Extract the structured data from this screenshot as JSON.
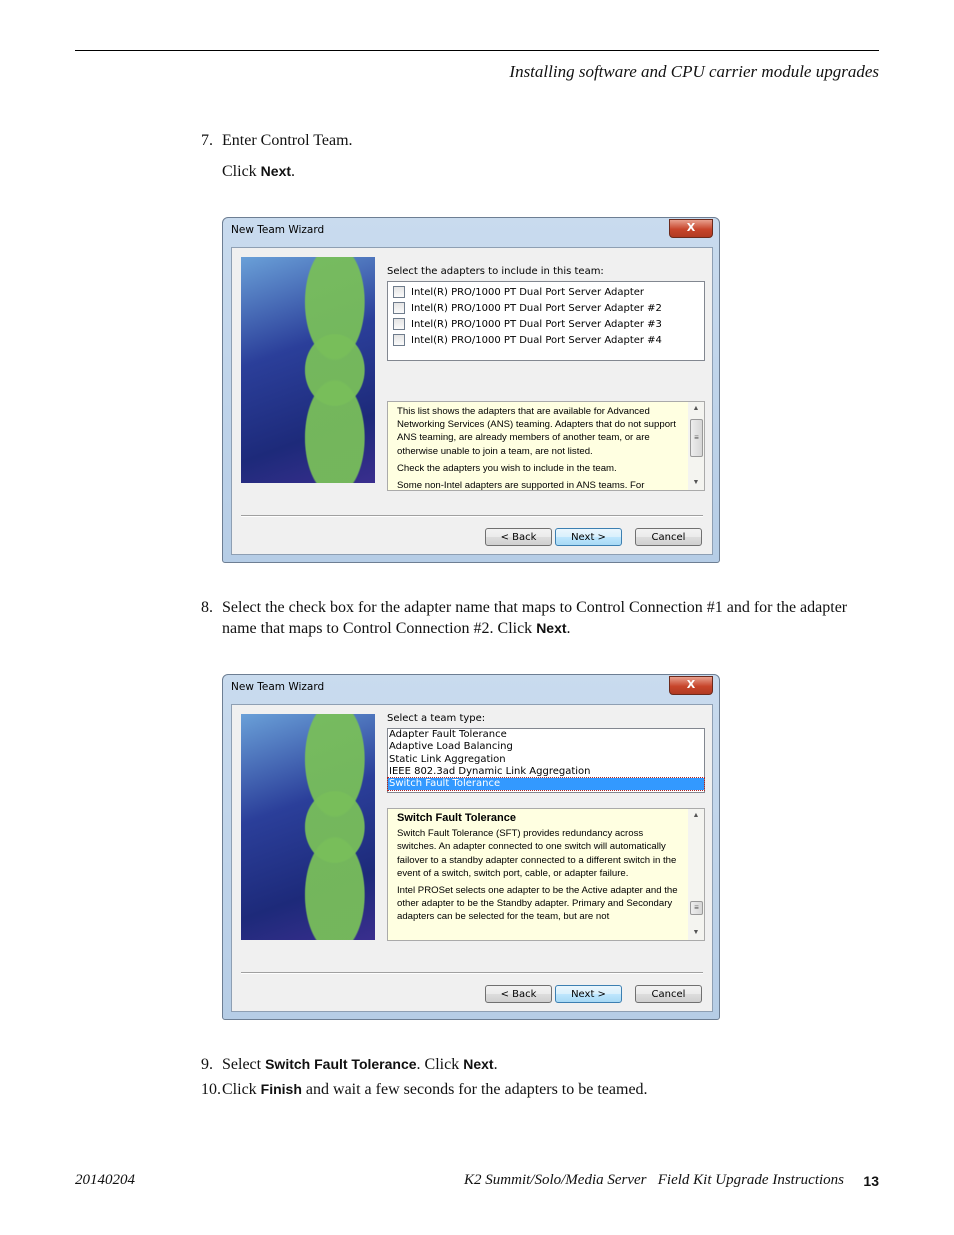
{
  "header": {
    "running_head": "Installing software and CPU carrier module upgrades"
  },
  "steps": {
    "s7": {
      "num": "7.",
      "text": "Enter Control Team.",
      "click_pre": "Click ",
      "click_bold": "Next",
      "click_post": "."
    },
    "s8": {
      "num": "8.",
      "line1": "Select the check box for the adapter name that maps to Control Connection #1 and for the adapter",
      "line2_pre": "name that maps to Control Connection #2. Click ",
      "line2_bold": "Next",
      "line2_post": "."
    },
    "s9": {
      "num": "9.",
      "pre": "Select ",
      "bold1": "Switch Fault Tolerance",
      "mid": ". Click ",
      "bold2": "Next",
      "post": "."
    },
    "s10": {
      "num": "10.",
      "pre": "Click ",
      "bold": "Finish",
      "post": " and wait a few seconds for the adapters to be teamed."
    }
  },
  "dialog1": {
    "title": "New Team Wizard",
    "close_glyph": "X",
    "label": "Select the adapters to include in this team:",
    "adapters": [
      {
        "name": "Intel(R) PRO/1000 PT Dual Port Server Adapter",
        "checked": false
      },
      {
        "name": "Intel(R) PRO/1000 PT Dual Port Server Adapter #2",
        "checked": false
      },
      {
        "name": "Intel(R) PRO/1000 PT Dual Port Server Adapter #3",
        "checked": false
      },
      {
        "name": "Intel(R) PRO/1000 PT Dual Port Server Adapter #4",
        "checked": false
      }
    ],
    "info_p1": "This list shows the adapters that are available for Advanced Networking Services (ANS) teaming. Adapters that do not support ANS teaming, are already members of another team, or are otherwise unable to join a team, are not listed.",
    "info_p2": "Check the adapters you wish to include in the team.",
    "info_p3": "Some non-Intel adapters are supported in ANS teams. For",
    "buttons": {
      "back": "< Back",
      "next": "Next >",
      "cancel": "Cancel"
    }
  },
  "dialog2": {
    "title": "New Team Wizard",
    "close_glyph": "X",
    "label": "Select a team type:",
    "team_types": [
      "Adapter Fault Tolerance",
      "Adaptive Load Balancing",
      "Static Link Aggregation",
      "IEEE 802.3ad Dynamic Link Aggregation",
      "Switch Fault Tolerance"
    ],
    "selected": "Switch Fault Tolerance",
    "info_heading": "Switch Fault Tolerance",
    "info_p1": "Switch Fault Tolerance (SFT) provides redundancy across switches. An adapter connected to one switch will automatically failover to a standby adapter connected to a different switch in the event of a switch, switch port, cable, or adapter failure.",
    "info_p2": "Intel PROSet selects one adapter to be the Active adapter and the other adapter to be the Standby adapter. Primary and Secondary adapters can be selected for the team, but are not",
    "buttons": {
      "back": "< Back",
      "next": "Next >",
      "cancel": "Cancel"
    }
  },
  "footer": {
    "date": "20140204",
    "title": "K2 Summit/Solo/Media Server   Field Kit Upgrade Instructions",
    "page": "13"
  }
}
